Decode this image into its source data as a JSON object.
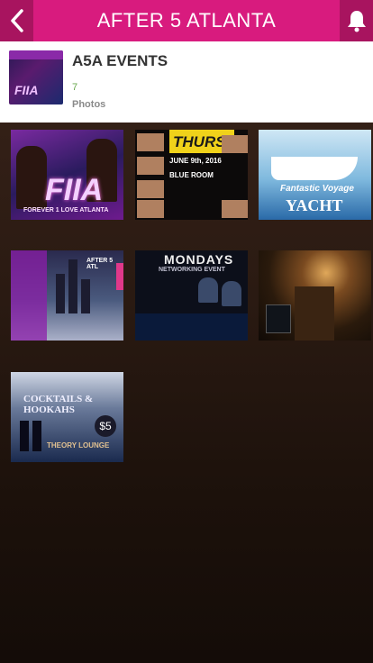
{
  "header": {
    "title": "AFTER 5 ATLANTA",
    "back_icon": "chevron-left-icon",
    "bell_icon": "bell-icon"
  },
  "album": {
    "name": "A5A EVENTS",
    "count": "7",
    "subtitle": "Photos",
    "thumb_text": "FIIA"
  },
  "photos": [
    {
      "id": "p1",
      "big": "FIIA",
      "small": "FOREVER 1 LOVE ATLANTA"
    },
    {
      "id": "p2",
      "headline": "THURSDAY",
      "date": "JUNE 9th, 2016",
      "venue": "BLUE ROOM"
    },
    {
      "id": "p3",
      "line1": "Fantastic Voyage",
      "line2": "YACHT"
    },
    {
      "id": "p4",
      "text": "AFTER 5 ATL"
    },
    {
      "id": "p5",
      "headline": "MONDAYS",
      "sub": "NETWORKING EVENT"
    },
    {
      "id": "p6"
    },
    {
      "id": "p7",
      "headline": "COCKTAILS & HOOKAHS",
      "price": "$5",
      "venue": "THEORY LOUNGE"
    }
  ],
  "colors": {
    "accent": "#d81b7e",
    "accent_dark": "#a8145f"
  }
}
